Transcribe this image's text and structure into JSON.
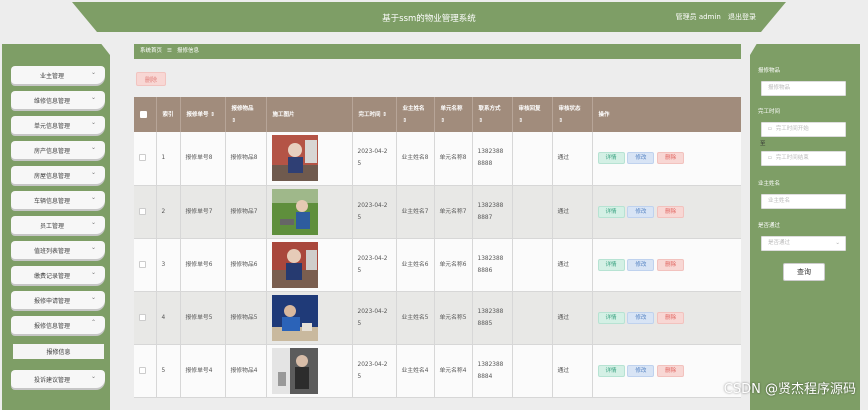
{
  "header": {
    "title": "基于ssm的物业管理系统",
    "user_role": "管理员 admin",
    "logout": "退出登录"
  },
  "sidebar": {
    "items": [
      {
        "label": "业主管理"
      },
      {
        "label": "维修信息管理"
      },
      {
        "label": "单元信息管理"
      },
      {
        "label": "房产信息管理"
      },
      {
        "label": "房屋信息管理"
      },
      {
        "label": "车辆信息管理"
      },
      {
        "label": "员工管理"
      },
      {
        "label": "值班列表管理"
      },
      {
        "label": "缴费记录管理"
      },
      {
        "label": "报修申请管理"
      },
      {
        "label": "报修信息管理"
      }
    ],
    "sub_item": "报修信息",
    "last_item": "投诉建议管理"
  },
  "breadcrumb": {
    "home": "系统首页",
    "sep": "☰",
    "current": "报修信息"
  },
  "toolbar": {
    "delete_label": "删除"
  },
  "table": {
    "headers": [
      "",
      "索引",
      "报修单号",
      "报修物品",
      "施工图片",
      "完工时间",
      "业主姓名",
      "单元名称",
      "联系方式",
      "审核回复",
      "审核状态",
      "操作"
    ],
    "rows": [
      {
        "idx": "1",
        "order": "报修单号8",
        "item": "报修物品8",
        "time": "2023-04-25",
        "owner": "业主姓名8",
        "unit": "单元名称8",
        "phone": "13823888888",
        "reply": "",
        "status": "通过"
      },
      {
        "idx": "2",
        "order": "报修单号7",
        "item": "报修物品7",
        "time": "2023-04-25",
        "owner": "业主姓名7",
        "unit": "单元名称7",
        "phone": "13823888887",
        "reply": "",
        "status": "通过"
      },
      {
        "idx": "3",
        "order": "报修单号6",
        "item": "报修物品6",
        "time": "2023-04-25",
        "owner": "业主姓名6",
        "unit": "单元名称6",
        "phone": "13823888886",
        "reply": "",
        "status": "通过"
      },
      {
        "idx": "4",
        "order": "报修单号5",
        "item": "报修物品5",
        "time": "2023-04-25",
        "owner": "业主姓名5",
        "unit": "单元名称5",
        "phone": "13823888885",
        "reply": "",
        "status": "通过"
      },
      {
        "idx": "5",
        "order": "报修单号4",
        "item": "报修物品4",
        "time": "2023-04-25",
        "owner": "业主姓名4",
        "unit": "单元名称4",
        "phone": "13823888884",
        "reply": "",
        "status": "通过"
      }
    ],
    "actions": {
      "detail": "详情",
      "edit": "修改",
      "delete": "删除"
    }
  },
  "search": {
    "item_label": "报修物品",
    "item_placeholder": "报修物品",
    "time_label": "完工时间",
    "time_start_placeholder": "完工时间开始",
    "to_label": "至",
    "time_end_placeholder": "完工时间结束",
    "owner_label": "业主姓名",
    "owner_placeholder": "业主姓名",
    "pass_label": "是否通过",
    "pass_placeholder": "是否通过",
    "button": "查询"
  },
  "watermark": "CSDN @贤杰程序源码",
  "colors": {
    "accent": "#7e9e66",
    "header_row": "#a18c7c"
  }
}
